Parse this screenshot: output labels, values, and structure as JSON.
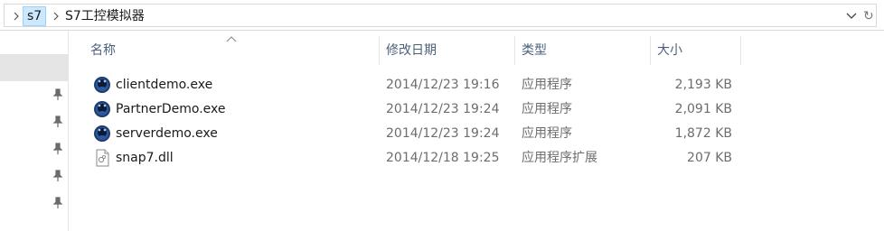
{
  "breadcrumb": {
    "items": [
      "s7",
      "S7工控模拟器"
    ]
  },
  "columns": {
    "name": "名称",
    "modified": "修改日期",
    "type": "类型",
    "size": "大小"
  },
  "files": [
    {
      "name": "clientdemo.exe",
      "modified": "2014/12/23 19:16",
      "type": "应用程序",
      "size": "2,193 KB",
      "icon": "app-exe-icon"
    },
    {
      "name": "PartnerDemo.exe",
      "modified": "2014/12/23 19:24",
      "type": "应用程序",
      "size": "2,091 KB",
      "icon": "app-exe-icon"
    },
    {
      "name": "serverdemo.exe",
      "modified": "2014/12/23 19:24",
      "type": "应用程序",
      "size": "1,872 KB",
      "icon": "app-exe-icon"
    },
    {
      "name": "snap7.dll",
      "modified": "2014/12/18 19:25",
      "type": "应用程序扩展",
      "size": "207 KB",
      "icon": "dll-file-icon"
    }
  ],
  "colors": {
    "selection": "#cce8ff",
    "header_text": "#4c607a",
    "nav_highlight": "#e5e5e5"
  }
}
